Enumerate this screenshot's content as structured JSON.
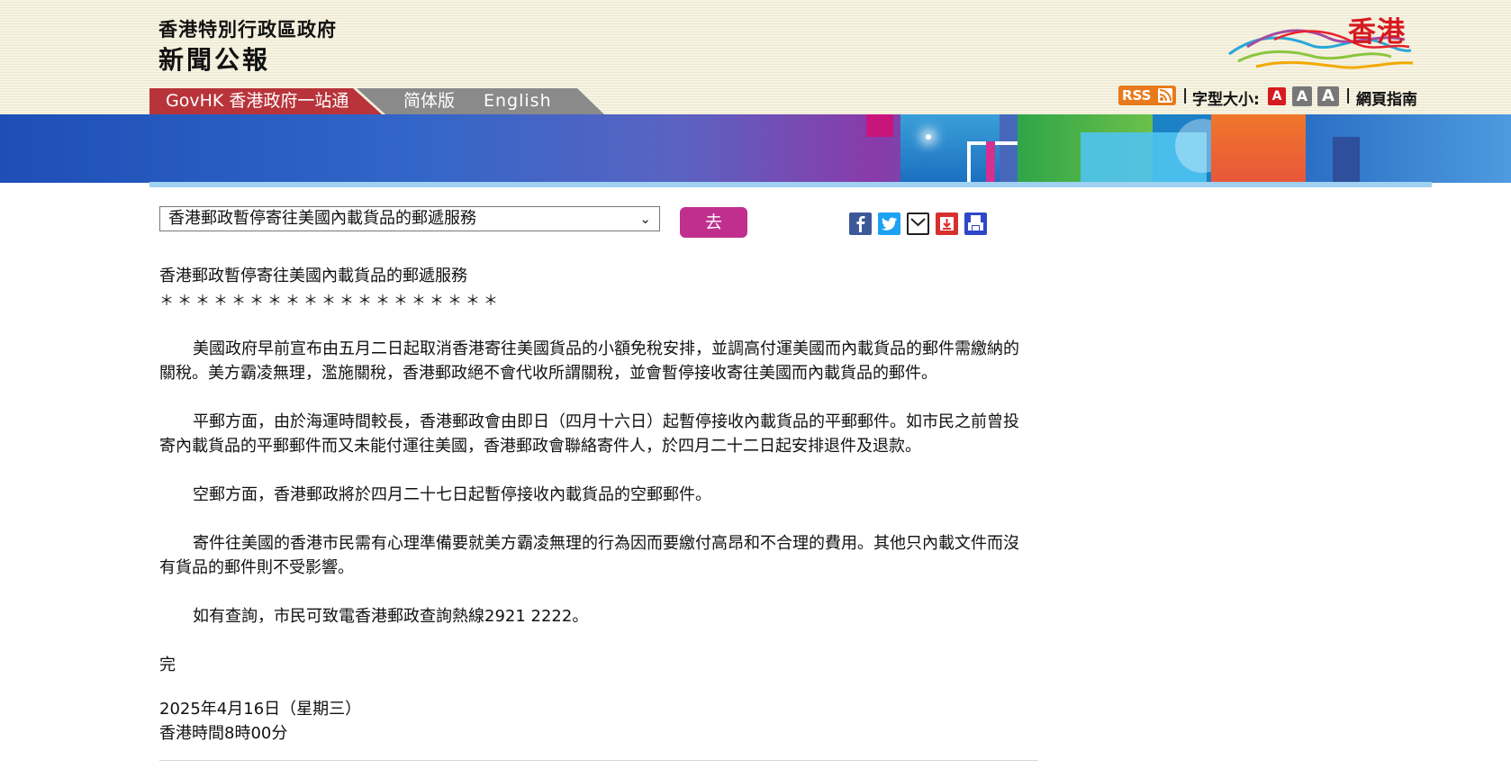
{
  "header": {
    "department": "香港特別行政區政府",
    "publication": "新聞公報",
    "logo_text": "香港"
  },
  "tabs": {
    "govhk": "GovHK 香港政府一站通",
    "simplified": "简体版",
    "english": "English"
  },
  "tools": {
    "rss": "RSS",
    "font_size_label": "字型大小:",
    "font_buttons": [
      "A",
      "A",
      "A"
    ],
    "separator": "|",
    "guide": "網頁指南"
  },
  "selector": {
    "selected": "香港郵政暫停寄往美國內載貨品的郵遞服務",
    "go_label": "去"
  },
  "share_icons": [
    "facebook-icon",
    "twitter-icon",
    "email-icon",
    "download-icon",
    "print-icon"
  ],
  "article": {
    "title": "香港郵政暫停寄往美國內載貨品的郵遞服務",
    "stars": "＊＊＊＊＊＊＊＊＊＊＊＊＊＊＊＊＊＊＊",
    "paragraphs": [
      "美國政府早前宣布由五月二日起取消香港寄往美國貨品的小額免稅安排，並調高付運美國而內載貨品的郵件需繳納的關稅。美方霸凌無理，濫施關稅，香港郵政絕不會代收所謂關稅，並會暫停接收寄往美國而內載貨品的郵件。",
      "平郵方面，由於海運時間較長，香港郵政會由即日（四月十六日）起暫停接收內載貨品的平郵郵件。如市民之前曾投寄內載貨品的平郵郵件而又未能付運往美國，香港郵政會聯絡寄件人，於四月二十二日起安排退件及退款。",
      "空郵方面，香港郵政將於四月二十七日起暫停接收內載貨品的空郵郵件。",
      "寄件往美國的香港市民需有心理準備要就美方霸凌無理的行為因而要繳付高昂和不合理的費用。其他只內載文件而沒有貨品的郵件則不受影響。",
      "如有查詢，市民可致電香港郵政查詢熱線2921 2222。"
    ],
    "end": "完",
    "date": "2025年4月16日（星期三）",
    "time": "香港時間8時00分"
  },
  "colors": {
    "govhk_tab": "#b8343a",
    "go_button": "#c02f8e",
    "rss": "#e87a1d",
    "logo_red": "#d71920"
  }
}
